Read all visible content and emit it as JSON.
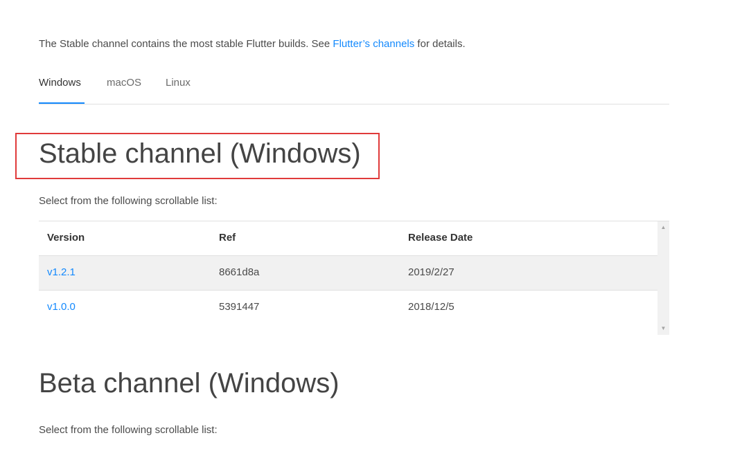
{
  "intro": {
    "text_before": "The Stable channel contains the most stable Flutter builds. See ",
    "link_text": "Flutter’s channels",
    "text_after": " for details."
  },
  "tabs": [
    {
      "label": "Windows",
      "active": true
    },
    {
      "label": "macOS",
      "active": false
    },
    {
      "label": "Linux",
      "active": false
    }
  ],
  "stable": {
    "title": "Stable channel (Windows)",
    "subtext": "Select from the following scrollable list:",
    "table": {
      "headers": [
        "Version",
        "Ref",
        "Release Date"
      ],
      "rows": [
        {
          "version": "v1.2.1",
          "ref": "8661d8a",
          "date": "2019/2/27"
        },
        {
          "version": "v1.0.0",
          "ref": "5391447",
          "date": "2018/12/5"
        }
      ]
    }
  },
  "beta": {
    "title": "Beta channel (Windows)",
    "subtext": "Select from the following scrollable list:"
  },
  "scrollbar": {
    "up_icon": "▲",
    "down_icon": "▼"
  },
  "colors": {
    "link": "#1389fd",
    "highlight": "#e03a3a",
    "row_shade": "#f1f1f1"
  }
}
